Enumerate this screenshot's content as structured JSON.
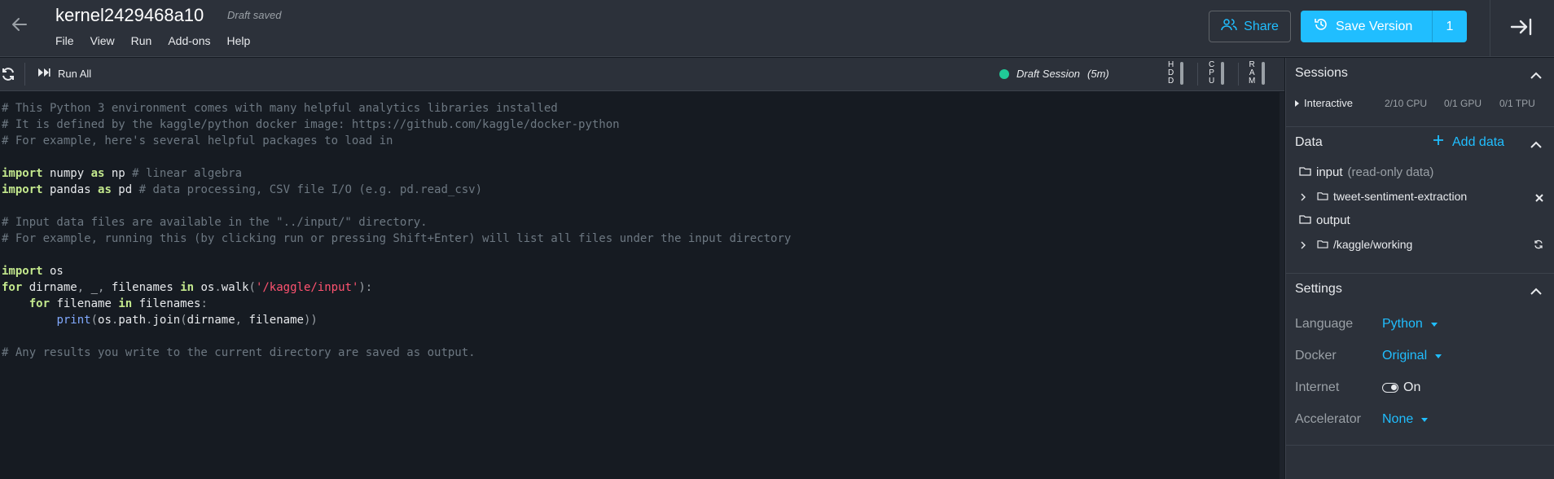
{
  "header": {
    "title": "kernel2429468a10",
    "draft_status": "Draft saved",
    "menu": [
      "File",
      "View",
      "Run",
      "Add-ons",
      "Help"
    ],
    "share_label": "Share",
    "save_label": "Save Version",
    "save_count": "1"
  },
  "toolbar": {
    "run_all_label": "Run All",
    "session_label": "Draft Session",
    "session_time": "(5m)",
    "meters": [
      "HDD",
      "CPU",
      "RAM"
    ]
  },
  "code": [
    "# This Python 3 environment comes with many helpful analytics libraries installed",
    "# It is defined by the kaggle/python docker image: https://github.com/kaggle/docker-python",
    "# For example, here's several helpful packages to load in",
    "",
    "import numpy as np # linear algebra",
    "import pandas as pd # data processing, CSV file I/O (e.g. pd.read_csv)",
    "",
    "# Input data files are available in the \"../input/\" directory.",
    "# For example, running this (by clicking run or pressing Shift+Enter) will list all files under the input directory",
    "",
    "import os",
    "for dirname, _, filenames in os.walk('/kaggle/input'):",
    "    for filename in filenames:",
    "        print(os.path.join(dirname, filename))",
    "",
    "# Any results you write to the current directory are saved as output."
  ],
  "sidebar": {
    "sessions": {
      "title": "Sessions",
      "name": "Interactive",
      "cpu": "2/10 CPU",
      "gpu": "0/1 GPU",
      "tpu": "0/1 TPU"
    },
    "data": {
      "title": "Data",
      "add_label": "Add data",
      "input_label": "input",
      "input_note": "(read-only data)",
      "dataset": "tweet-sentiment-extraction",
      "output_label": "output",
      "working": "/kaggle/working"
    },
    "settings": {
      "title": "Settings",
      "language_label": "Language",
      "language_value": "Python",
      "docker_label": "Docker",
      "docker_value": "Original",
      "internet_label": "Internet",
      "internet_value": "On",
      "accelerator_label": "Accelerator",
      "accelerator_value": "None"
    }
  },
  "colors": {
    "accent": "#20beff",
    "session_dot": "#20c997",
    "background": "#161b22",
    "panel": "#2c313a"
  }
}
